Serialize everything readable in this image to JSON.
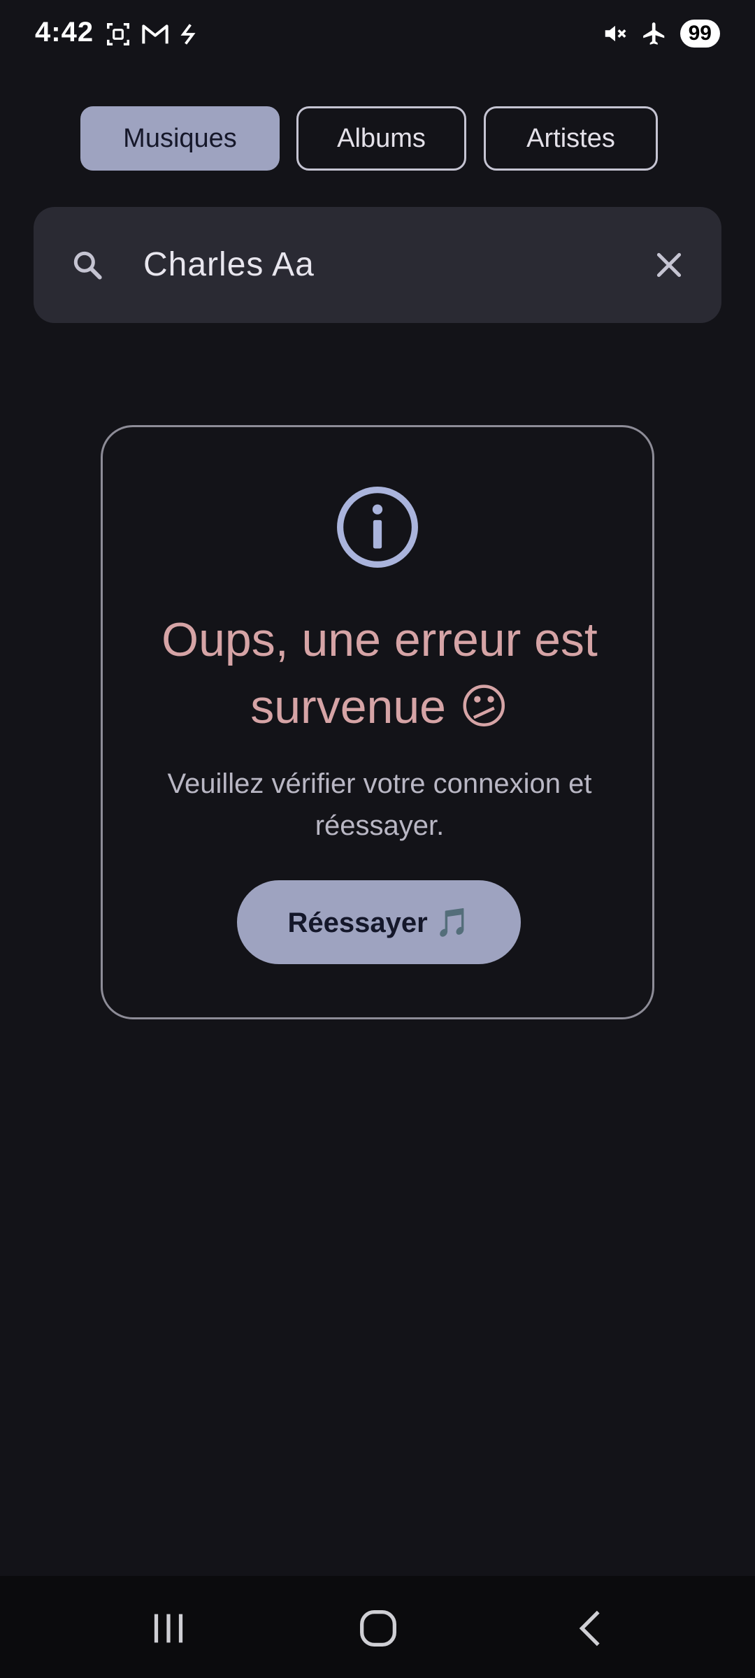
{
  "status_bar": {
    "time": "4:42",
    "battery": "99",
    "left_icons": [
      "screenshot-icon",
      "gmail-icon",
      "sync-icon"
    ],
    "right_icons": [
      "mute-icon",
      "airplane-icon"
    ]
  },
  "tabs": [
    {
      "label": "Musiques",
      "selected": true
    },
    {
      "label": "Albums",
      "selected": false
    },
    {
      "label": "Artistes",
      "selected": false
    }
  ],
  "search": {
    "value": "Charles Aa",
    "icon": "search-icon",
    "clear_icon": "close-icon"
  },
  "error": {
    "icon": "info-icon",
    "title": "Oups, une erreur est survenue 😕",
    "message": "Veuillez vérifier votre connexion et réessayer.",
    "retry_label": "Réessayer 🎵"
  },
  "nav": {
    "icons": [
      "recent-apps-icon",
      "home-icon",
      "back-icon"
    ]
  },
  "colors": {
    "background": "#131318",
    "accent": "#9ea3c0",
    "error_title": "#d6a4a6",
    "search_bg": "#2a2a33"
  }
}
